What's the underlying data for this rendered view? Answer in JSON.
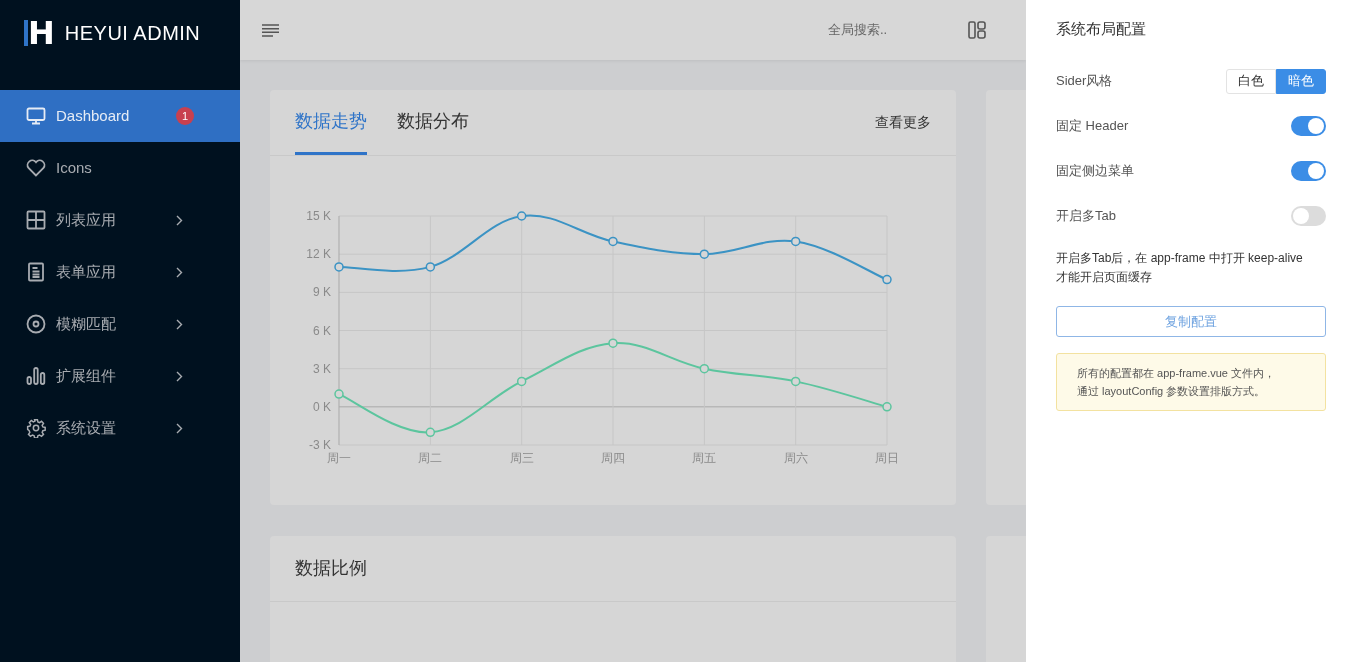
{
  "sidebar": {
    "logo": {
      "mark": "H",
      "text": "HEYUI ADMIN"
    },
    "items": [
      {
        "label": "Dashboard",
        "selected": true,
        "badge": "1",
        "has_children": false
      },
      {
        "label": "Icons",
        "selected": false,
        "has_children": false
      },
      {
        "label": "列表应用",
        "selected": false,
        "has_children": true
      },
      {
        "label": "表单应用",
        "selected": false,
        "has_children": true
      },
      {
        "label": "模糊匹配",
        "selected": false,
        "has_children": true
      },
      {
        "label": "扩展组件",
        "selected": false,
        "has_children": true
      },
      {
        "label": "系统设置",
        "selected": false,
        "has_children": true
      }
    ]
  },
  "header": {
    "search": {
      "placeholder": "全局搜索.."
    }
  },
  "cards": [
    {
      "tabs": [
        {
          "label": "数据走势",
          "selected": true
        },
        {
          "label": "数据分布",
          "selected": false
        }
      ],
      "more": "查看更多",
      "chart_data": {
        "type": "line",
        "categories": [
          "周一",
          "周二",
          "周三",
          "周四",
          "周五",
          "周六",
          "周日"
        ],
        "series": [
          {
            "color": "#3b93c4",
            "marker": "circle",
            "values": [
              11000,
              11000,
              15000,
              13000,
              12000,
              13000,
              10000
            ]
          },
          {
            "color": "#5cc59e",
            "marker": "circle",
            "values": [
              1000,
              -2000,
              2000,
              5000,
              3000,
              2000,
              0
            ]
          }
        ],
        "ylim": [
          -3000,
          15000
        ],
        "grid": true,
        "yticks": [
          {
            "value": -3000,
            "label": "-3 K"
          },
          {
            "value": 0,
            "label": "0 K"
          },
          {
            "value": 3000,
            "label": "3 K"
          },
          {
            "value": 6000,
            "label": "6 K"
          },
          {
            "value": 9000,
            "label": "9 K"
          },
          {
            "value": 12000,
            "label": "12 K"
          },
          {
            "value": 15000,
            "label": "15 K"
          }
        ]
      }
    },
    {
      "title": "数据比例"
    }
  ],
  "settings": {
    "title": "系统布局配置",
    "sider_style": {
      "label": "Sider风格",
      "options": [
        {
          "label": "白色",
          "selected": false
        },
        {
          "label": "暗色",
          "selected": true
        }
      ]
    },
    "toggles": [
      {
        "label": "固定 Header",
        "on": true
      },
      {
        "label": "固定侧边菜单",
        "on": true
      },
      {
        "label": "开启多Tab",
        "on": false
      }
    ],
    "note": "开启多Tab后，在 app-frame 中打开 keep-alive 才能开启页面缓存",
    "copy_button": "复制配置",
    "notice": [
      "所有的配置都在 app-frame.vue 文件内，",
      "通过 layoutConfig 参数设置排版方式。"
    ]
  }
}
